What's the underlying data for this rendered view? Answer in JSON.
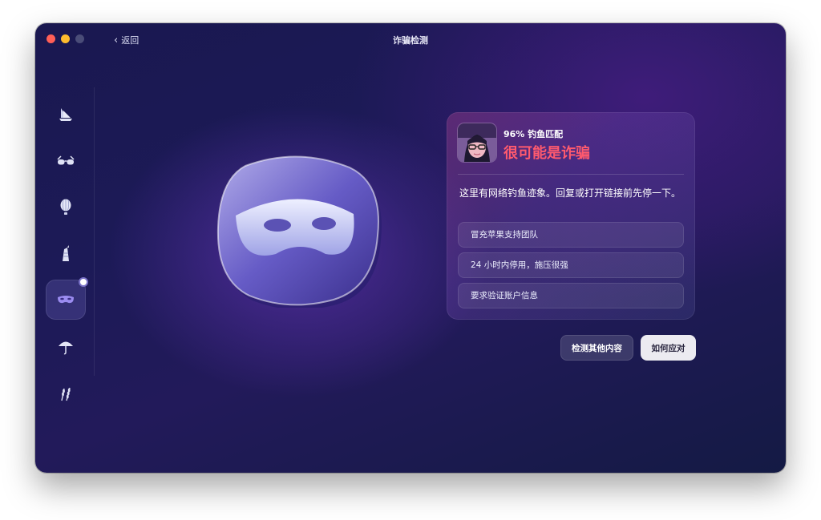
{
  "window": {
    "title": "诈骗检测"
  },
  "nav": {
    "back_label": "返回"
  },
  "sidebar": {
    "items": [
      {
        "icon": "ship-icon",
        "active": false
      },
      {
        "icon": "glasses-icon",
        "active": false
      },
      {
        "icon": "balloon-icon",
        "active": false
      },
      {
        "icon": "tower-icon",
        "active": false
      },
      {
        "icon": "mask-icon",
        "active": true
      },
      {
        "icon": "umbrella-icon",
        "active": false
      },
      {
        "icon": "wheat-icon",
        "active": false
      }
    ]
  },
  "hero": {
    "icon": "mask-icon"
  },
  "result": {
    "match_label": "96% 钓鱼匹配",
    "match_percent": 96,
    "verdict": "很可能是诈骗",
    "description": "这里有网络钓鱼迹象。回复或打开链接前先停一下。",
    "reasons": [
      "冒充苹果支持团队",
      "24 小时内停用，施压很强",
      "要求验证账户信息"
    ]
  },
  "actions": {
    "scan_more_label": "检测其他内容",
    "respond_label": "如何应对"
  },
  "colors": {
    "verdict": "#ff5a6e",
    "accent": "#7a72c8"
  }
}
